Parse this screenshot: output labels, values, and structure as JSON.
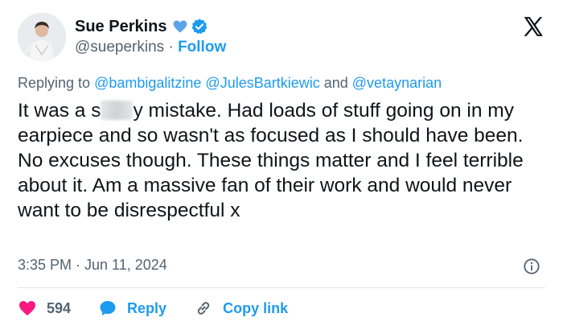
{
  "author": {
    "name": "Sue Perkins",
    "handle": "@sueperkins",
    "separator": " · ",
    "follow_label": "Follow"
  },
  "reply_context": {
    "prefix": "Replying to ",
    "mention1": "@bambigalitzine",
    "mention2": "@JulesBartkiewic",
    "and": " and ",
    "mention3": "@vetaynarian"
  },
  "tweet": {
    "text_before": "It was a s",
    "text_after": "y mistake. Had loads of stuff going on in my earpiece and so wasn't as focused as I should have been. No excuses though. These things matter and I feel terrible about it. Am a massive fan of their work and would never want to be disrespectful x",
    "timestamp": "3:35 PM · Jun 11, 2024"
  },
  "actions": {
    "like_count": "594",
    "reply_label": "Reply",
    "copy_label": "Copy link"
  },
  "colors": {
    "accent": "#1d9bf0",
    "heart": "#f91880",
    "secondary_text": "#536471"
  },
  "icons": [
    "x-logo-icon",
    "blue-heart-icon",
    "verified-badge-icon",
    "info-icon",
    "heart-icon",
    "reply-bubble-icon",
    "link-icon"
  ]
}
